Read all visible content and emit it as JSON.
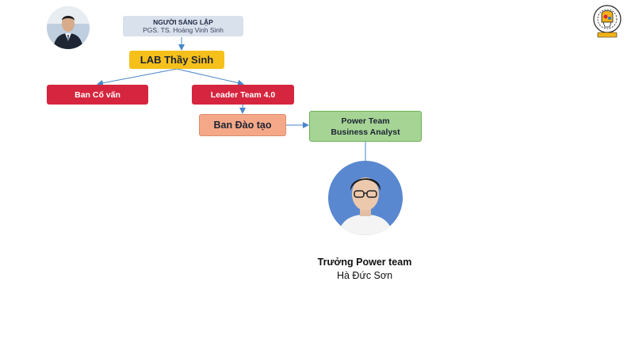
{
  "founder": {
    "title": "NGƯỜI SÁNG LẬP",
    "name": "PGS. TS. Hoàng Vinh Sinh"
  },
  "lab": {
    "label": "LAB Thầy Sinh"
  },
  "advisor": {
    "label": "Ban Cố vấn"
  },
  "leader": {
    "label": "Leader Team 4.0"
  },
  "training": {
    "label": "Ban Đào tạo"
  },
  "power_team": {
    "line1": "Power Team",
    "line2": "Business Analyst"
  },
  "head": {
    "title": "Trưởng Power team",
    "name": "Hà Đức Sơn"
  },
  "colors": {
    "connector": "#4a86c8",
    "founder_box": "#d9e1ec",
    "lab_box": "#f6c01b",
    "red_box": "#d6253e",
    "training_box": "#f5a888",
    "power_box": "#a5d494"
  },
  "icons": {
    "founder_photo": "person-avatar",
    "head_photo": "person-avatar",
    "logo": "lab-emblem-logo"
  }
}
